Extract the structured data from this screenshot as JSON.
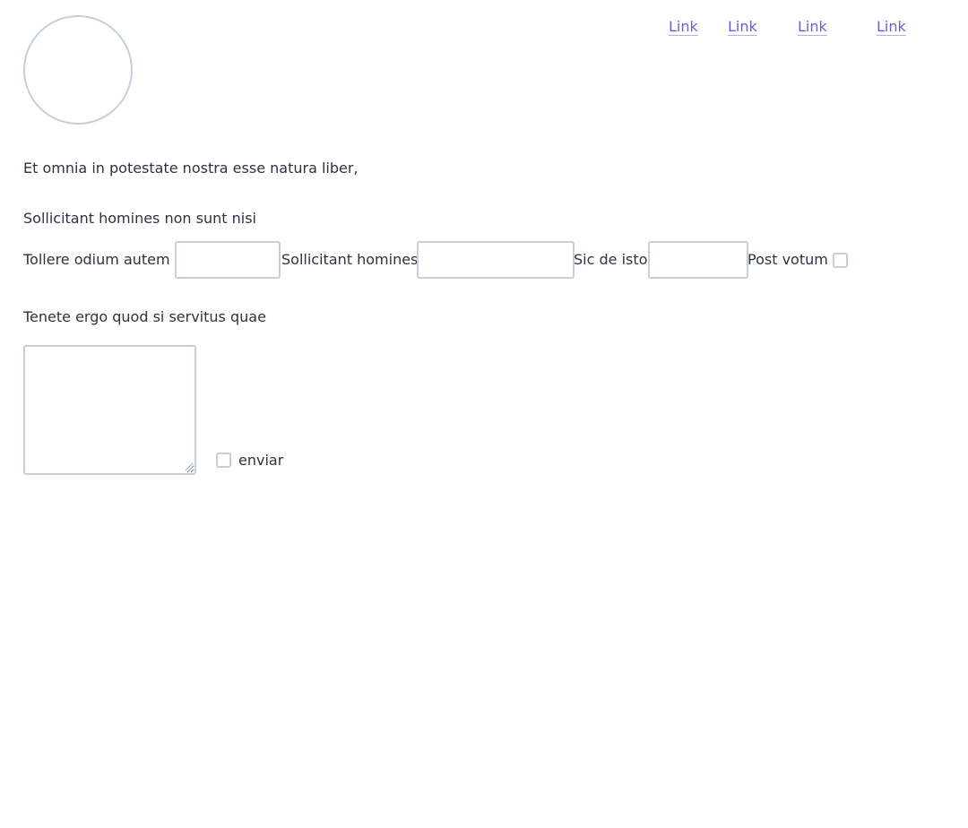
{
  "nav": {
    "links": [
      "Link",
      "Link",
      "Link",
      "Link"
    ]
  },
  "intro": {
    "line1": "Et omnia in potestate nostra esse natura liber,",
    "line2": "Sollicitant homines non sunt nisi"
  },
  "form_row": {
    "field1_label": "Tollere odium autem",
    "field1_value": "",
    "field2_label": "Sollicitant homines",
    "field2_value": "",
    "field3_label": "Sic de isto",
    "field3_value": "",
    "checkbox_label": "Post votum",
    "checkbox_checked": false
  },
  "section": {
    "heading": "Tenete ergo quod si servitus quae",
    "textarea_value": "",
    "send_label": "enviar",
    "send_checked": false
  },
  "colors": {
    "link": "#6a5be0",
    "border": "#c5d0da",
    "text": "#2b3440"
  }
}
